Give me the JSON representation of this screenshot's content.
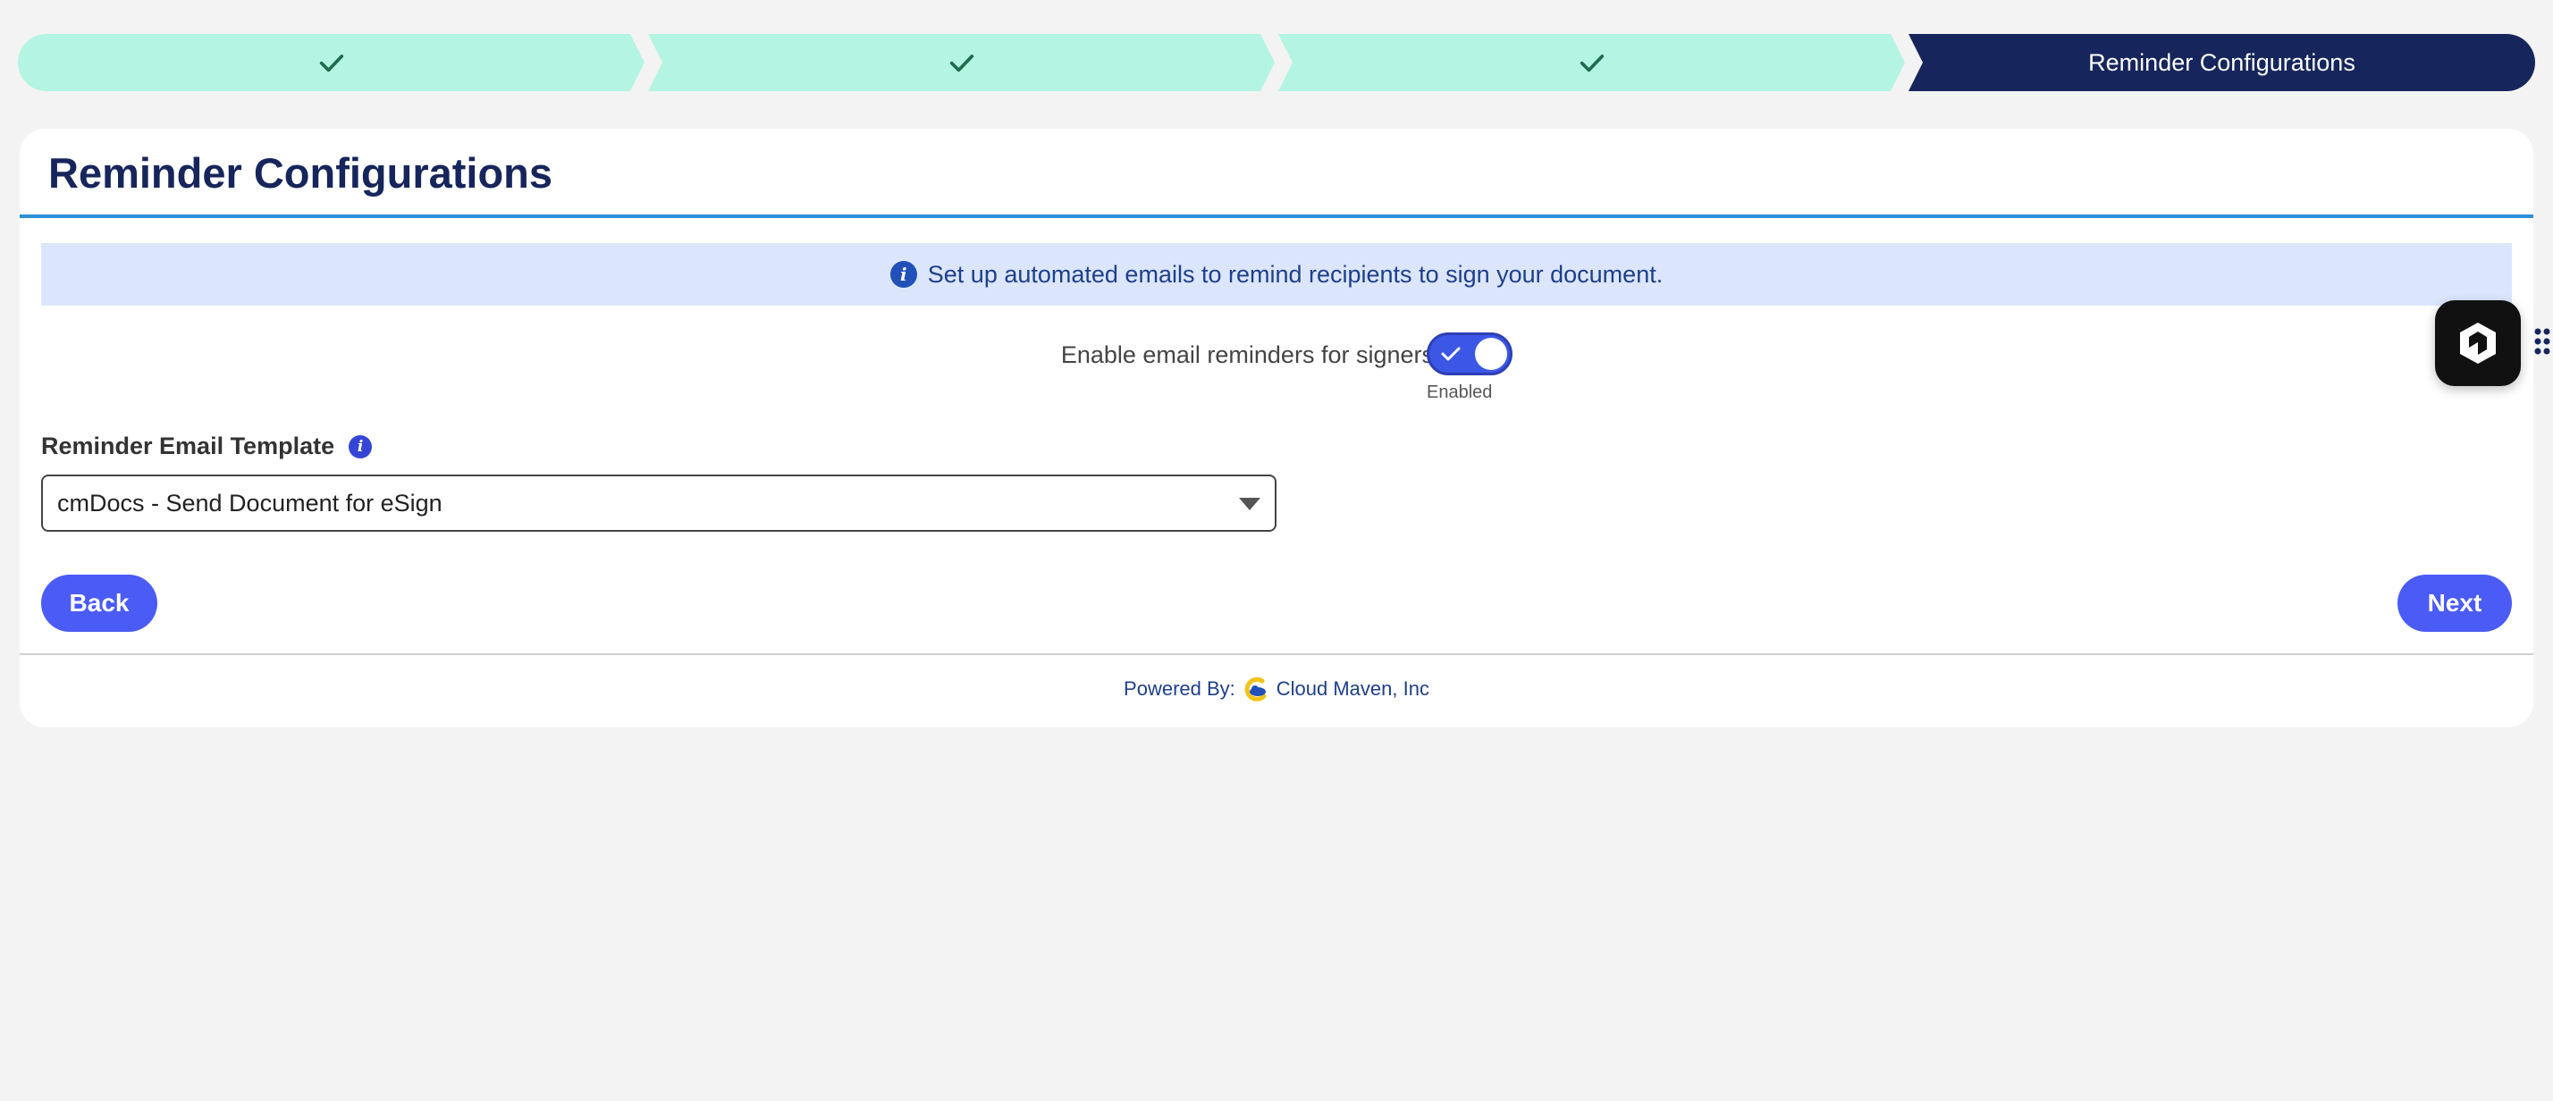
{
  "path": {
    "steps": [
      {
        "state": "complete",
        "icon": "check-icon"
      },
      {
        "state": "complete",
        "icon": "check-icon"
      },
      {
        "state": "complete",
        "icon": "check-icon"
      },
      {
        "state": "current",
        "label": "Reminder Configurations"
      }
    ]
  },
  "card": {
    "title": "Reminder Configurations",
    "info_banner": "Set up automated emails to remind recipients to sign your document.",
    "toggle": {
      "label": "Enable email reminders for signers",
      "checked": true,
      "state_text": "Enabled"
    },
    "template_field": {
      "label": "Reminder Email Template",
      "selected_value": "cmDocs - Send Document for eSign"
    },
    "buttons": {
      "back": "Back",
      "next": "Next"
    },
    "footer": {
      "powered_by": "Powered By:",
      "company": "Cloud Maven, Inc"
    }
  },
  "colors": {
    "complete_step": "#b3f5e2",
    "current_step": "#16265c",
    "accent_button": "#4b5bf5",
    "banner_bg": "#dbe6fd"
  }
}
